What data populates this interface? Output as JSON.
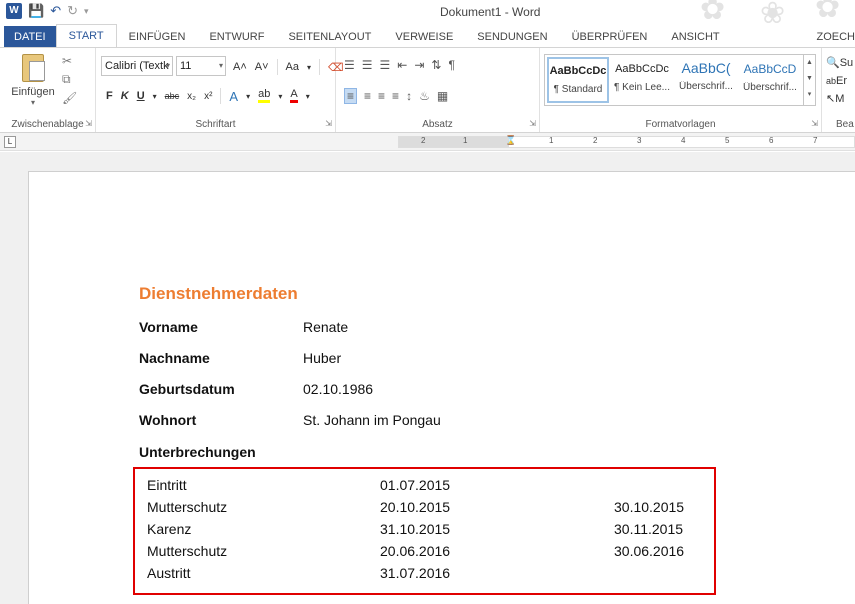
{
  "window": {
    "title": "Dokument1 - Word",
    "app_icon": "W"
  },
  "tabs": [
    {
      "label": "DATEI"
    },
    {
      "label": "START"
    },
    {
      "label": "EINFÜGEN"
    },
    {
      "label": "ENTWURF"
    },
    {
      "label": "SEITENLAYOUT"
    },
    {
      "label": "VERWEISE"
    },
    {
      "label": "SENDUNGEN"
    },
    {
      "label": "ÜBERPRÜFEN"
    },
    {
      "label": "ANSICHT"
    },
    {
      "label": "ZOECH"
    }
  ],
  "ribbon": {
    "clipboard": {
      "paste_label": "Einfügen",
      "group_label": "Zwischenablage"
    },
    "font": {
      "font_name": "Calibri (Textk",
      "font_size": "11",
      "grow": "A˄",
      "shrink": "A˅",
      "case": "Aa",
      "bold": "F",
      "italic": "K",
      "underline": "U",
      "strike": "abc",
      "subscript": "x₂",
      "superscript": "x²",
      "effect": "A",
      "highlight": "ab",
      "font_color": "A",
      "group_label": "Schriftart"
    },
    "paragraph": {
      "group_label": "Absatz"
    },
    "styles": {
      "items": [
        {
          "preview": "AaBbCcDc",
          "name": "¶ Standard"
        },
        {
          "preview": "AaBbCcDc",
          "name": "¶ Kein Lee..."
        },
        {
          "preview": "AaBbC(",
          "name": "Überschrif..."
        },
        {
          "preview": "AaBbCcD",
          "name": "Überschrif..."
        }
      ],
      "group_label": "Formatvorlagen"
    },
    "editing": {
      "items": [
        "Su",
        "Er",
        "M"
      ],
      "group_label": "Bea"
    }
  },
  "ruler": {
    "numbers": [
      "2",
      "1",
      "1",
      "2",
      "3",
      "4",
      "5",
      "6",
      "7"
    ],
    "corner": "L"
  },
  "document": {
    "heading": "Dienstnehmerdaten",
    "fields": [
      {
        "label": "Vorname",
        "value": "Renate"
      },
      {
        "label": "Nachname",
        "value": "Huber"
      },
      {
        "label": "Geburtsdatum",
        "value": "02.10.1986"
      },
      {
        "label": "Wohnort",
        "value": "St. Johann im Pongau"
      }
    ],
    "breaks_label": "Unterbrechungen",
    "breaks": [
      {
        "type": "Eintritt",
        "start": "01.07.2015",
        "end": ""
      },
      {
        "type": "Mutterschutz",
        "start": "20.10.2015",
        "end": "30.10.2015"
      },
      {
        "type": "Karenz",
        "start": "31.10.2015",
        "end": "30.11.2015"
      },
      {
        "type": "Mutterschutz",
        "start": "20.06.2016",
        "end": "30.06.2016"
      },
      {
        "type": "Austritt",
        "start": "31.07.2016",
        "end": ""
      }
    ]
  },
  "colors": {
    "accent": "#2b579a",
    "heading": "#ed7d31",
    "highlight_box": "#e00000"
  }
}
